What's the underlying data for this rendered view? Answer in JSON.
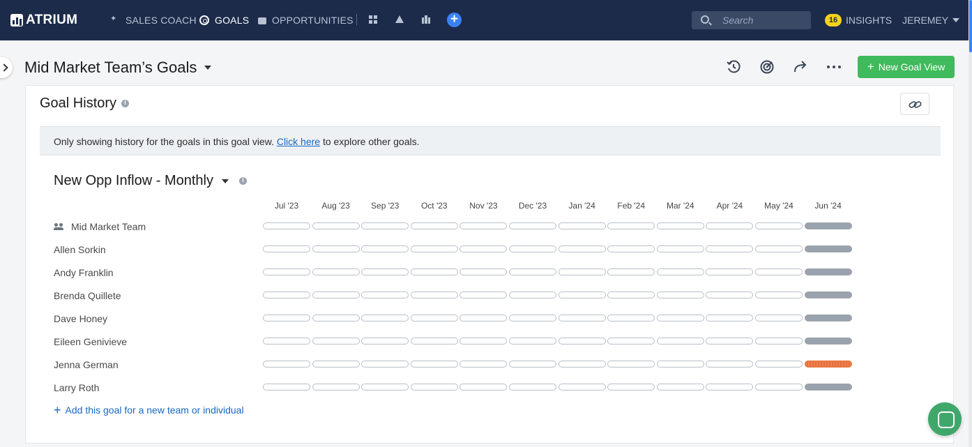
{
  "app": {
    "logo_text": "ATRIUM",
    "nav": [
      {
        "label": "SALES COACH",
        "icon": "sparkle-icon"
      },
      {
        "label": "GOALS",
        "icon": "target-icon"
      },
      {
        "label": "OPPORTUNITIES",
        "icon": "briefcase-icon"
      }
    ],
    "search_placeholder": "Search",
    "insights_count": "16",
    "insights_label": "INSIGHTS",
    "user_label": "JEREMEY"
  },
  "header": {
    "title": "Mid Market Team’s Goals",
    "new_goal_label": "New Goal View"
  },
  "card": {
    "title": "Goal History",
    "notice_before": "Only showing history for the goals in this goal view.",
    "notice_link": "Click here",
    "notice_after": "to explore other goals.",
    "goal_title": "New Opp Inflow - Monthly",
    "months": [
      "Jul '23",
      "Aug '23",
      "Sep '23",
      "Oct '23",
      "Nov '23",
      "Dec '23",
      "Jan '24",
      "Feb '24",
      "Mar '24",
      "Apr '24",
      "May '24",
      "Jun '24"
    ],
    "rows": [
      {
        "name": "Mid Market Team",
        "team": true,
        "status": [
          "empty",
          "empty",
          "empty",
          "empty",
          "empty",
          "empty",
          "empty",
          "empty",
          "empty",
          "empty",
          "empty",
          "gray"
        ]
      },
      {
        "name": "Allen Sorkin",
        "status": [
          "empty",
          "empty",
          "empty",
          "empty",
          "empty",
          "empty",
          "empty",
          "empty",
          "empty",
          "empty",
          "empty",
          "gray"
        ]
      },
      {
        "name": "Andy Franklin",
        "status": [
          "empty",
          "empty",
          "empty",
          "empty",
          "empty",
          "empty",
          "empty",
          "empty",
          "empty",
          "empty",
          "empty",
          "gray"
        ]
      },
      {
        "name": "Brenda Quillete",
        "status": [
          "empty",
          "empty",
          "empty",
          "empty",
          "empty",
          "empty",
          "empty",
          "empty",
          "empty",
          "empty",
          "empty",
          "gray"
        ]
      },
      {
        "name": "Dave Honey",
        "status": [
          "empty",
          "empty",
          "empty",
          "empty",
          "empty",
          "empty",
          "empty",
          "empty",
          "empty",
          "empty",
          "empty",
          "gray"
        ]
      },
      {
        "name": "Eileen Genivieve",
        "status": [
          "empty",
          "empty",
          "empty",
          "empty",
          "empty",
          "empty",
          "empty",
          "empty",
          "empty",
          "empty",
          "empty",
          "gray"
        ]
      },
      {
        "name": "Jenna German",
        "status": [
          "empty",
          "empty",
          "empty",
          "empty",
          "empty",
          "empty",
          "empty",
          "empty",
          "empty",
          "empty",
          "empty",
          "orange"
        ]
      },
      {
        "name": "Larry Roth",
        "status": [
          "empty",
          "empty",
          "empty",
          "empty",
          "empty",
          "empty",
          "empty",
          "empty",
          "empty",
          "empty",
          "empty",
          "gray"
        ]
      }
    ],
    "add_link": "Add this goal for a new team or individual"
  },
  "colors": {
    "nav_bg": "#1c2b4a",
    "accent_green": "#3fba5c",
    "link_blue": "#1a66c2",
    "bar_gray": "#9aa3ad",
    "bar_orange": "#e8703a"
  }
}
